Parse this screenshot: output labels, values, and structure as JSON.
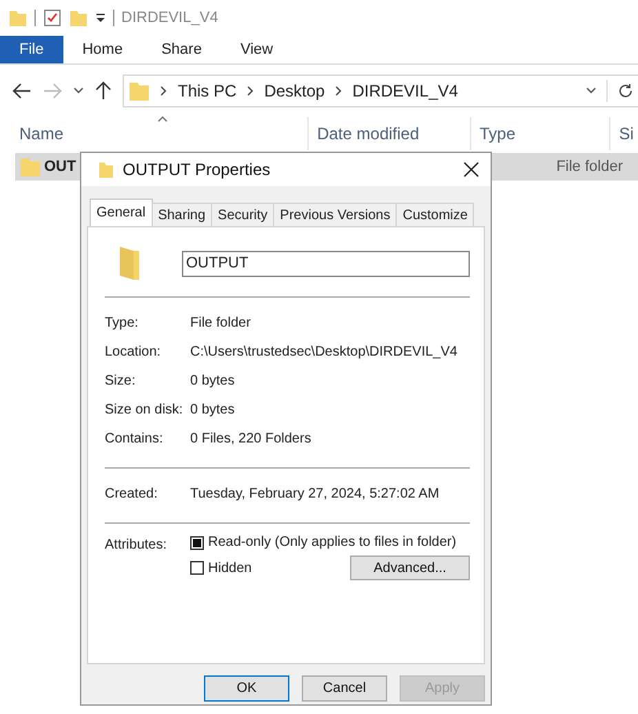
{
  "window": {
    "title": "DIRDEVIL_V4"
  },
  "ribbon_tabs": [
    {
      "label": "File",
      "selected": true
    },
    {
      "label": "Home",
      "selected": false
    },
    {
      "label": "Share",
      "selected": false
    },
    {
      "label": "View",
      "selected": false
    }
  ],
  "address": {
    "breadcrumbs": [
      "This PC",
      "Desktop",
      "DIRDEVIL_V4"
    ]
  },
  "columns": [
    "Name",
    "Date modified",
    "Type",
    "Si"
  ],
  "rows": [
    {
      "name": "OUT",
      "type": "File folder",
      "selected": true
    }
  ],
  "dialog": {
    "title": "OUTPUT Properties",
    "tabs": [
      {
        "label": "General",
        "selected": true
      },
      {
        "label": "Sharing",
        "selected": false
      },
      {
        "label": "Security",
        "selected": false
      },
      {
        "label": "Previous Versions",
        "selected": false
      },
      {
        "label": "Customize",
        "selected": false
      }
    ],
    "name_value": "OUTPUT",
    "groups": [
      [
        {
          "label": "Type:",
          "value": "File folder"
        },
        {
          "label": "Location:",
          "value": "C:\\Users\\trustedsec\\Desktop\\DIRDEVIL_V4"
        },
        {
          "label": "Size:",
          "value": "0 bytes"
        },
        {
          "label": "Size on disk:",
          "value": "0 bytes"
        },
        {
          "label": "Contains:",
          "value": "0 Files, 220 Folders"
        }
      ],
      [
        {
          "label": "Created:",
          "value": "Tuesday, February 27, 2024, 5:27:02 AM"
        }
      ]
    ],
    "attributes": {
      "label": "Attributes:",
      "options": [
        {
          "label": "Read-only (Only applies to files in folder)",
          "checked": false,
          "indeterminate": true
        },
        {
          "label": "Hidden",
          "checked": false,
          "indeterminate": false
        }
      ],
      "advanced_button": "Advanced..."
    },
    "buttons": [
      {
        "label": "OK",
        "default": true,
        "disabled": false
      },
      {
        "label": "Cancel",
        "default": false,
        "disabled": false
      },
      {
        "label": "Apply",
        "default": false,
        "disabled": true
      }
    ]
  }
}
